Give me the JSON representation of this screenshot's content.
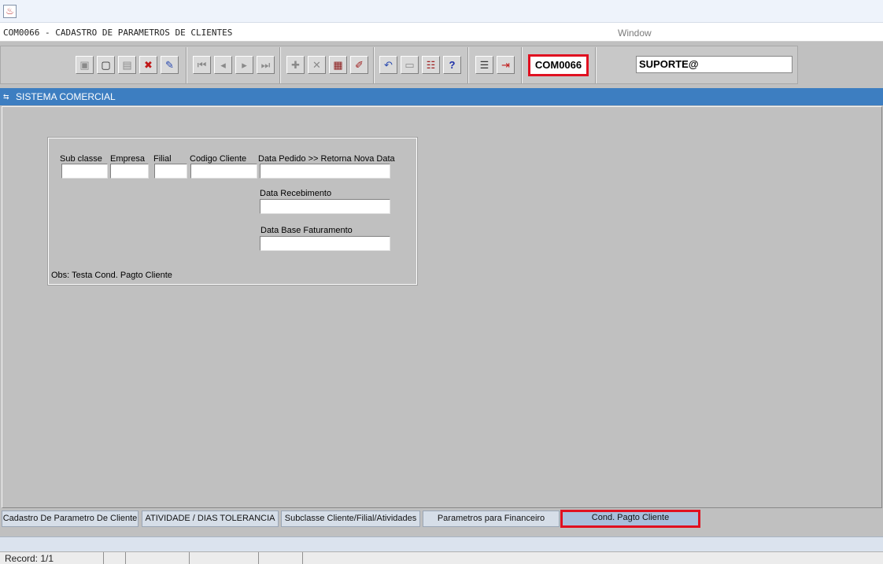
{
  "window": {
    "form_caption": "COM0066 - CADASTRO DE PARAMETROS DE CLIENTES",
    "menu_window": "Window"
  },
  "toolbar": {
    "buttons": [
      {
        "name": "save-icon",
        "glyph": "▣"
      },
      {
        "name": "screen-icon",
        "glyph": "▢"
      },
      {
        "name": "print-icon",
        "glyph": "▤"
      },
      {
        "name": "clear-icon",
        "glyph": "✖"
      },
      {
        "name": "query-icon",
        "glyph": "✎"
      },
      {
        "name": "first-record-icon",
        "glyph": "⏮"
      },
      {
        "name": "previous-record-icon",
        "glyph": "◂"
      },
      {
        "name": "next-record-icon",
        "glyph": "▸"
      },
      {
        "name": "last-record-icon",
        "glyph": "⏭"
      },
      {
        "name": "insert-record-icon",
        "glyph": "✚"
      },
      {
        "name": "delete-record-icon",
        "glyph": "✕"
      },
      {
        "name": "duplicate-record-icon",
        "glyph": "▦"
      },
      {
        "name": "edit-record-icon",
        "glyph": "✐"
      },
      {
        "name": "undo-icon",
        "glyph": "↶"
      },
      {
        "name": "clipboard-icon",
        "glyph": "▭"
      },
      {
        "name": "list-values-icon",
        "glyph": "☷"
      },
      {
        "name": "help-icon",
        "glyph": "?"
      },
      {
        "name": "menu-icon",
        "glyph": "☰"
      },
      {
        "name": "exit-icon",
        "glyph": "⇥"
      }
    ],
    "form_code": "COM0066",
    "user": "SUPORTE@"
  },
  "section": {
    "title": "SISTEMA COMERCIAL"
  },
  "form": {
    "labels": {
      "sub_classe": "Sub classe",
      "empresa": "Empresa",
      "filial": "Filial",
      "codigo_cliente": "Codigo Cliente",
      "data_pedido": "Data Pedido >> Retorna Nova Data",
      "data_recebimento": "Data Recebimento",
      "data_base_faturamento": "Data Base Faturamento"
    },
    "values": {
      "sub_classe": "",
      "empresa": "",
      "filial": "",
      "codigo_cliente": "",
      "data_pedido": "",
      "data_recebimento": "",
      "data_base_faturamento": ""
    },
    "obs": "Obs: Testa Cond. Pagto Cliente"
  },
  "tabs": [
    "Cadastro De Parametro De Cliente",
    "ATIVIDADE / DIAS TOLERANCIA",
    "Subclasse Cliente/Filial/Atividades",
    "Parametros para Financeiro",
    "Cond. Pagto Cliente"
  ],
  "status": {
    "record": "Record: 1/1"
  }
}
